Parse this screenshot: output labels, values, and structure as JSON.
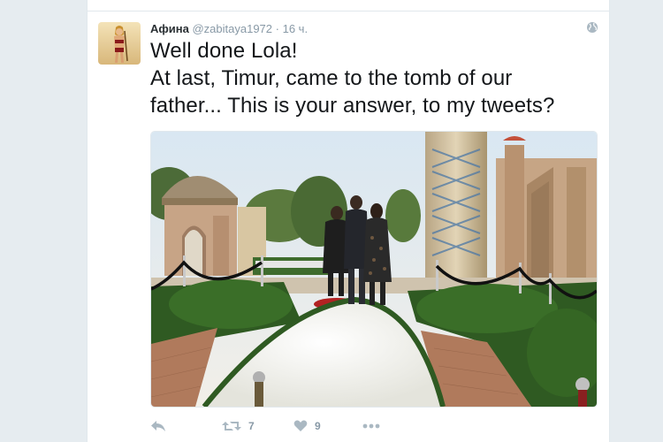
{
  "tweet": {
    "author_name": "Афина",
    "username": "@zabitaya1972",
    "separator": "·",
    "timestamp": "16 ч.",
    "lines": [
      "Well done Lola!",
      "At last, Timur, came to the tomb of our",
      "father... This is your answer, to my tweets?"
    ]
  },
  "actions": {
    "retweet_count": "7",
    "like_count": "9"
  },
  "icons": {
    "globe": "globe-icon",
    "reply": "reply-icon",
    "retweet": "retweet-icon",
    "like": "heart-icon",
    "more": "more-icon"
  },
  "colors": {
    "text": "#14171a",
    "muted": "#8899a6",
    "icon": "#aab8c2",
    "border": "#e1e8ed",
    "background": "#e6ecf0"
  }
}
